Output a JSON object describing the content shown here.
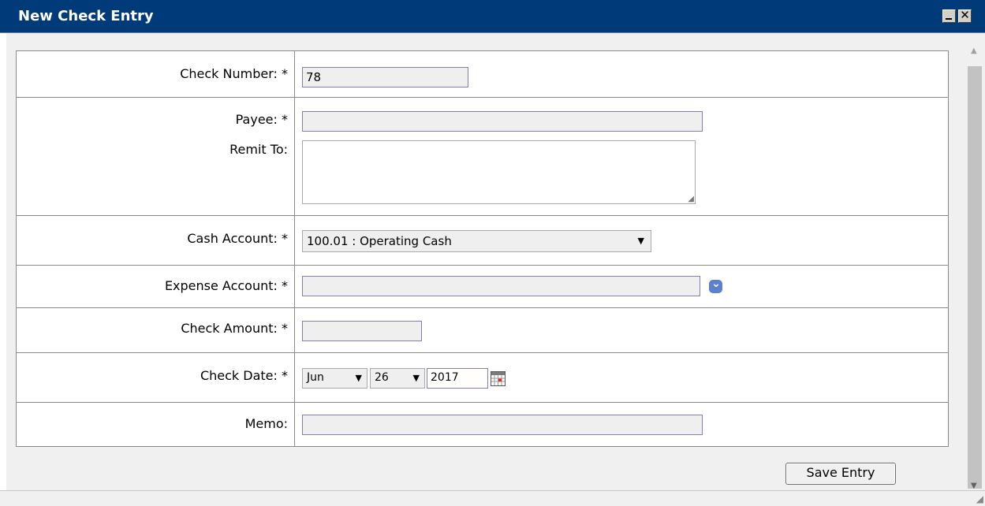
{
  "window": {
    "title": "New Check Entry"
  },
  "fields": {
    "check_number": {
      "label": "Check Number: *",
      "value": "78"
    },
    "payee": {
      "label": "Payee: *",
      "value": ""
    },
    "remit_to": {
      "label": "Remit To:",
      "value": ""
    },
    "cash_account": {
      "label": "Cash Account: *",
      "selected": "100.01 : Operating Cash"
    },
    "expense_account": {
      "label": "Expense Account: *",
      "value": ""
    },
    "check_amount": {
      "label": "Check Amount: *",
      "value": ""
    },
    "check_date": {
      "label": "Check Date: *",
      "month": "Jun",
      "day": "26",
      "year": "2017"
    },
    "memo": {
      "label": "Memo:",
      "value": ""
    }
  },
  "actions": {
    "save_label": "Save Entry"
  },
  "icons": {
    "minimize": "minimize-icon",
    "close": "close-icon",
    "calendar": "calendar-icon",
    "dropdown": "chevron-down-icon"
  },
  "colors": {
    "title_bar": "#003a78",
    "field_border": "#7f7fbf",
    "dropdown_button": "#5c80d0"
  }
}
